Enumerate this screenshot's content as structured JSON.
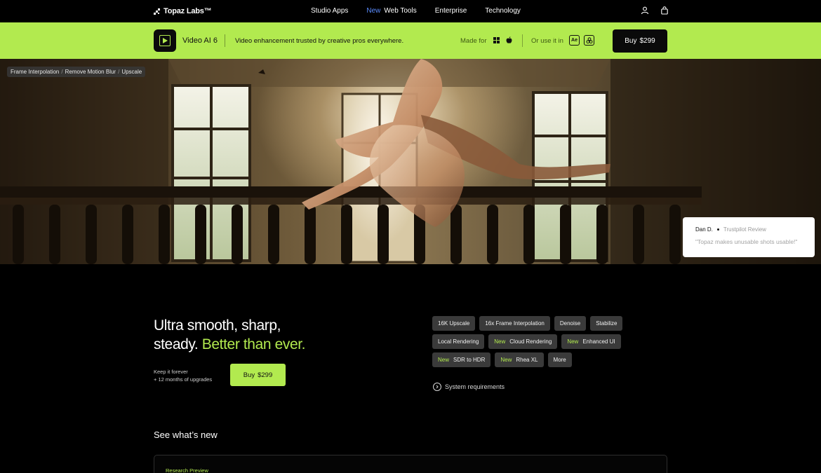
{
  "topnav": {
    "logo": "Topaz Labs™",
    "links": [
      {
        "label": "Studio Apps",
        "new": ""
      },
      {
        "label": "Web Tools",
        "new": "New"
      },
      {
        "label": "Enterprise",
        "new": ""
      },
      {
        "label": "Technology",
        "new": ""
      }
    ],
    "icons": [
      "user-icon",
      "shopping-bag-icon"
    ]
  },
  "productbar": {
    "name": "Video AI 6",
    "tagline": "Video enhancement trusted by creative pros everywhere.",
    "made_for": "Made for",
    "os_icons": [
      "windows-icon",
      "apple-icon"
    ],
    "use_it_in": "Or use it in",
    "plugins": [
      "Ae",
      "resolve"
    ],
    "buy_label": "Buy",
    "buy_price": "$299",
    "colors": {
      "accent": "#b2ea4f"
    }
  },
  "hero": {
    "breadcrumb": [
      "Frame Interpolation",
      "Remove Motion Blur",
      "Upscale"
    ],
    "review": {
      "author": "Dan D.",
      "source": "Trustpilot Review",
      "quote": "\"Topaz makes unusable shots usable!\""
    }
  },
  "main": {
    "headline_line1": "Ultra smooth, sharp,",
    "headline_line2_white": "steady.",
    "headline_line2_green": "Better than ever.",
    "keep_line1": "Keep it forever",
    "keep_line2": "+ 12 months of upgrades",
    "buy_label": "Buy",
    "buy_price": "$299",
    "features": [
      {
        "new": "",
        "label": "16K Upscale"
      },
      {
        "new": "",
        "label": "16x Frame Interpolation"
      },
      {
        "new": "",
        "label": "Denoise"
      },
      {
        "new": "",
        "label": "Stabilize"
      },
      {
        "new": "",
        "label": "Local Rendering"
      },
      {
        "new": "New",
        "label": "Cloud Rendering"
      },
      {
        "new": "New",
        "label": "Enhanced UI"
      },
      {
        "new": "New",
        "label": "SDR to HDR"
      },
      {
        "new": "New",
        "label": "Rhea XL"
      },
      {
        "new": "",
        "label": "More"
      }
    ],
    "system_requirements": "System requirements",
    "see_whats_new": "See what’s new",
    "card_label": "Research Preview"
  }
}
